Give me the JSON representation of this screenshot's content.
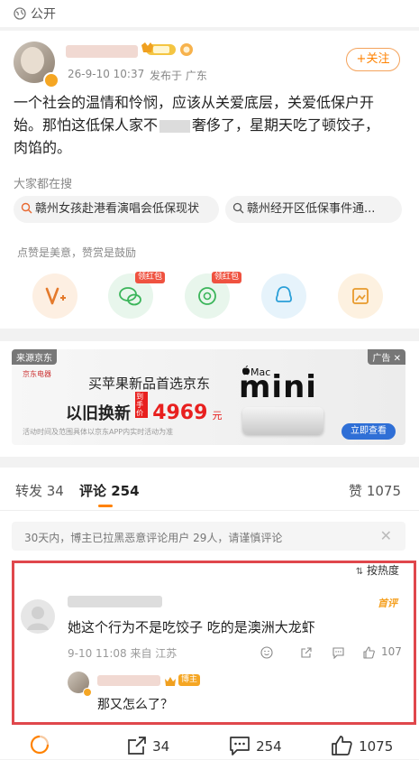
{
  "visibility": {
    "label": "公开"
  },
  "post": {
    "timestamp": "26-9-10 10:37",
    "source": "发布于 广东",
    "follow_label": "+关注",
    "text_line1": "一个社会的温情和怜悯，应该从关爱底层，关爱低保户开",
    "text_line2a": "始。那怕这低保人家不",
    "text_line2b": "奢侈了，星期天吃了顿饺子，",
    "text_line3": "肉馅的。"
  },
  "search": {
    "heading": "大家都在搜",
    "items": [
      "赣州女孩赴港看演唱会低保现状",
      "赣州经开区低保事件通..."
    ]
  },
  "reward": {
    "heading": "点赞是美意，赞赏是鼓励",
    "badge": "领红包"
  },
  "ad": {
    "source": "来源京东",
    "ad_label": "广告",
    "logo_text": "京东电器",
    "headline": "买苹果新品首选京东",
    "promo_prefix": "以旧换新",
    "promo_tag": "到手价",
    "price": "4969",
    "price_unit": "元",
    "fineprint": "活动时间及范围具体以京东APP内实时活动为准",
    "brand": "Mac",
    "product": "mini",
    "cta": "立即查看"
  },
  "tabs": {
    "repost": "转发 34",
    "comments": "评论 254",
    "likes": "赞 1075"
  },
  "notice": {
    "text": "30天内，博主已拉黑恶意评论用户 29人，请谨慎评论"
  },
  "sort": {
    "label": "按热度"
  },
  "comment": {
    "tag": "首评",
    "text": "她这个行为不是吃饺子 吃的是澳洲大龙虾",
    "meta": "9-10 11:08 来自 江苏",
    "like_count": "107",
    "reply_badge": "博主",
    "reply_text": "那又怎么了？"
  },
  "bottom": {
    "repost_count": "34",
    "comment_count": "254",
    "like_count": "1075"
  },
  "colors": {
    "accent": "#ff8200",
    "highlight_border": "#e0474c",
    "link_blue": "#507daf"
  }
}
